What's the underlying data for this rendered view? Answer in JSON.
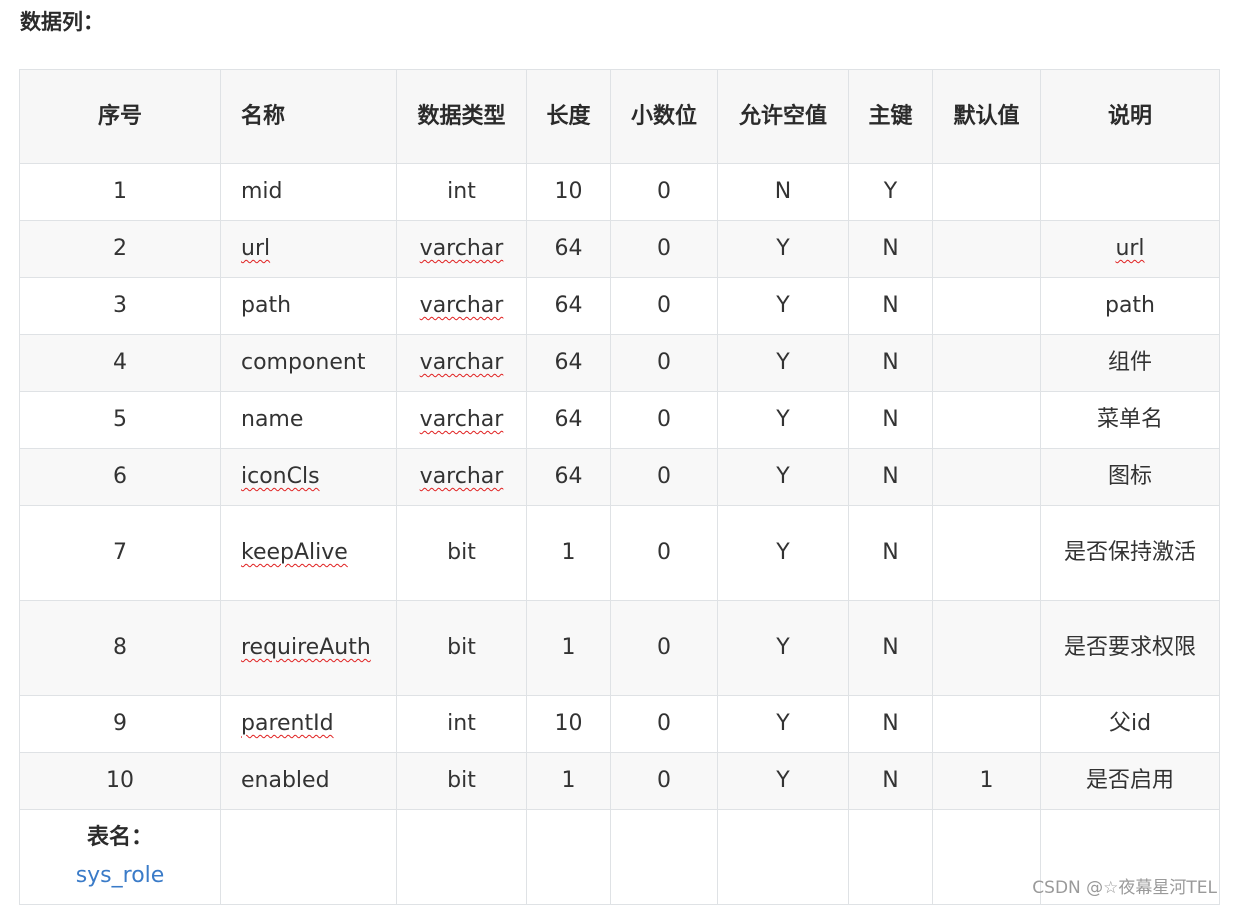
{
  "section_title": "数据列：",
  "headers": [
    "序号",
    "名称",
    "数据类型",
    "长度",
    "小数位",
    "允许空值",
    "主键",
    "默认值",
    "说明"
  ],
  "rows": [
    {
      "no": "1",
      "name": "mid",
      "type": "int",
      "len": "10",
      "dec": "0",
      "nullable": "N",
      "pk": "Y",
      "def": "",
      "desc": ""
    },
    {
      "no": "2",
      "name": "url",
      "type": "varchar",
      "len": "64",
      "dec": "0",
      "nullable": "Y",
      "pk": "N",
      "def": "",
      "desc": "url"
    },
    {
      "no": "3",
      "name": "path",
      "type": "varchar",
      "len": "64",
      "dec": "0",
      "nullable": "Y",
      "pk": "N",
      "def": "",
      "desc": "path"
    },
    {
      "no": "4",
      "name": "component",
      "type": "varchar",
      "len": "64",
      "dec": "0",
      "nullable": "Y",
      "pk": "N",
      "def": "",
      "desc": "组件"
    },
    {
      "no": "5",
      "name": "name",
      "type": "varchar",
      "len": "64",
      "dec": "0",
      "nullable": "Y",
      "pk": "N",
      "def": "",
      "desc": "菜单名"
    },
    {
      "no": "6",
      "name": "iconCls",
      "type": "varchar",
      "len": "64",
      "dec": "0",
      "nullable": "Y",
      "pk": "N",
      "def": "",
      "desc": "图标"
    },
    {
      "no": "7",
      "name": "keepAlive",
      "type": "bit",
      "len": "1",
      "dec": "0",
      "nullable": "Y",
      "pk": "N",
      "def": "",
      "desc": "是否保持激活"
    },
    {
      "no": "8",
      "name": "requireAuth",
      "type": "bit",
      "len": "1",
      "dec": "0",
      "nullable": "Y",
      "pk": "N",
      "def": "",
      "desc": "是否要求权限"
    },
    {
      "no": "9",
      "name": "parentId",
      "type": "int",
      "len": "10",
      "dec": "0",
      "nullable": "Y",
      "pk": "N",
      "def": "",
      "desc": "父id"
    },
    {
      "no": "10",
      "name": "enabled",
      "type": "bit",
      "len": "1",
      "dec": "0",
      "nullable": "Y",
      "pk": "N",
      "def": "1",
      "desc": "是否启用"
    }
  ],
  "table_name": {
    "label": "表名：",
    "value": "sys_role"
  },
  "watermark": "CSDN @☆夜幕星河TEL",
  "colors": {
    "header_bg": "#f7f7f7",
    "border": "#dfe2e5",
    "link": "#3a7bc8",
    "spell_underline": "#e02020"
  }
}
